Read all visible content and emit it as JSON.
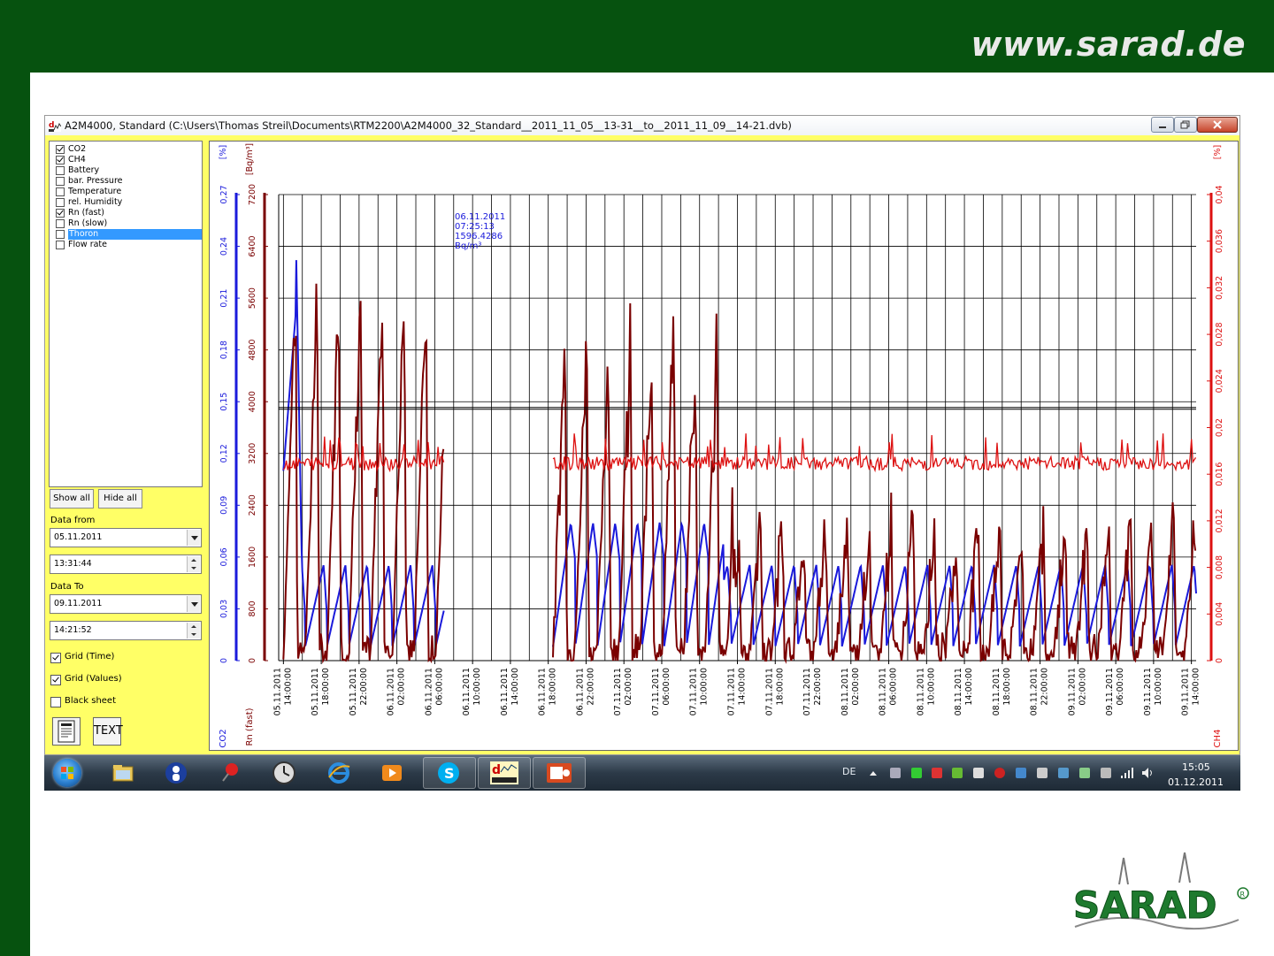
{
  "slide": {
    "url": "www.sarad.de",
    "logo_text": "SARAD"
  },
  "window": {
    "title": "A2M4000, Standard (C:\\Users\\Thomas Streil\\Documents\\RTM2200\\A2M4000_32_Standard__2011_11_05__13-31__to__2011_11_09__14-21.dvb)"
  },
  "channels": [
    {
      "label": "CO2",
      "checked": true,
      "selected": false
    },
    {
      "label": "CH4",
      "checked": true,
      "selected": false
    },
    {
      "label": "Battery",
      "checked": false,
      "selected": false
    },
    {
      "label": "bar. Pressure",
      "checked": false,
      "selected": false
    },
    {
      "label": "Temperature",
      "checked": false,
      "selected": false
    },
    {
      "label": "rel. Humidity",
      "checked": false,
      "selected": false
    },
    {
      "label": "Rn (fast)",
      "checked": true,
      "selected": false
    },
    {
      "label": "Rn (slow)",
      "checked": false,
      "selected": false
    },
    {
      "label": "Thoron",
      "checked": false,
      "selected": true
    },
    {
      "label": "Flow rate",
      "checked": false,
      "selected": false
    }
  ],
  "controls": {
    "show_all": "Show all",
    "hide_all": "Hide all",
    "data_from_label": "Data from",
    "data_from_date": "05.11.2011",
    "data_from_time": "13:31:44",
    "data_to_label": "Data To",
    "data_to_date": "09.11.2011",
    "data_to_time": "14:21:52",
    "grid_time": {
      "label": "Grid (Time)",
      "checked": true
    },
    "grid_values": {
      "label": "Grid (Values)",
      "checked": true
    },
    "black_sheet": {
      "label": "Black sheet",
      "checked": false
    },
    "text_button": "TEXT"
  },
  "chart_data": {
    "type": "line",
    "axes": {
      "co2": {
        "unit": "[%]",
        "name": "CO2",
        "color": "#1a1adb",
        "range": [
          0,
          0.27
        ],
        "ticks": [
          "0",
          "0,03",
          "0,06",
          "0,09",
          "0,12",
          "0,15",
          "0,18",
          "0,21",
          "0,24",
          "0,27"
        ]
      },
      "rn": {
        "unit": "[Bq/m³]",
        "name": "Rn (fast)",
        "color": "#7a0000",
        "range": [
          0,
          7200
        ],
        "ticks": [
          "0",
          "800",
          "1600",
          "2400",
          "3200",
          "4000",
          "4800",
          "5600",
          "6400",
          "7200"
        ]
      },
      "ch4": {
        "unit": "[%]",
        "name": "CH4",
        "color": "#dd1111",
        "range": [
          0,
          0.04
        ],
        "ticks": [
          "0",
          "0,004",
          "0,008",
          "0,012",
          "0,016",
          "0,02",
          "0,024",
          "0,028",
          "0,032",
          "0,036",
          "0,04"
        ]
      }
    },
    "x_ticks": [
      [
        "05.11.2011",
        "14:00:00"
      ],
      [
        "05.11.2011",
        "18:00:00"
      ],
      [
        "05.11.2011",
        "22:00:00"
      ],
      [
        "06.11.2011",
        "02:00:00"
      ],
      [
        "06.11.2011",
        "06:00:00"
      ],
      [
        "06.11.2011",
        "10:00:00"
      ],
      [
        "06.11.2011",
        "14:00:00"
      ],
      [
        "06.11.2011",
        "18:00:00"
      ],
      [
        "06.11.2011",
        "22:00:00"
      ],
      [
        "07.11.2011",
        "02:00:00"
      ],
      [
        "07.11.2011",
        "06:00:00"
      ],
      [
        "07.11.2011",
        "10:00:00"
      ],
      [
        "07.11.2011",
        "14:00:00"
      ],
      [
        "07.11.2011",
        "18:00:00"
      ],
      [
        "07.11.2011",
        "22:00:00"
      ],
      [
        "08.11.2011",
        "02:00:00"
      ],
      [
        "08.11.2011",
        "06:00:00"
      ],
      [
        "08.11.2011",
        "10:00:00"
      ],
      [
        "08.11.2011",
        "14:00:00"
      ],
      [
        "08.11.2011",
        "18:00:00"
      ],
      [
        "08.11.2011",
        "22:00:00"
      ],
      [
        "09.11.2011",
        "02:00:00"
      ],
      [
        "09.11.2011",
        "06:00:00"
      ],
      [
        "09.11.2011",
        "10:00:00"
      ],
      [
        "09.11.2011",
        "14:00:00"
      ]
    ],
    "cursor": {
      "date": "06.11.2011",
      "time": "07:25:13",
      "value": "1596.4286",
      "unit": "Bq/m³"
    },
    "segments": [
      {
        "from_hour": 0.5,
        "to_hour": 17.5
      },
      {
        "from_hour": 29,
        "to_hour": 97
      }
    ],
    "series": [
      {
        "name": "CO2",
        "axis": "co2",
        "color": "#1a1adb",
        "approx_peak": 0.25,
        "approx_base": 0.008,
        "pattern": "sawtooth"
      },
      {
        "name": "Rn (fast)",
        "axis": "rn",
        "color": "#7a0000",
        "approx_peak": 6500,
        "approx_base": 0,
        "pattern": "spikes"
      },
      {
        "name": "CH4",
        "axis": "ch4",
        "color": "#dd1111",
        "approx_level": 0.017,
        "pattern": "noise"
      }
    ],
    "grid": true,
    "legend": "none"
  },
  "taskbar": {
    "lang": "DE",
    "time": "15:05",
    "date": "01.12.2011"
  }
}
